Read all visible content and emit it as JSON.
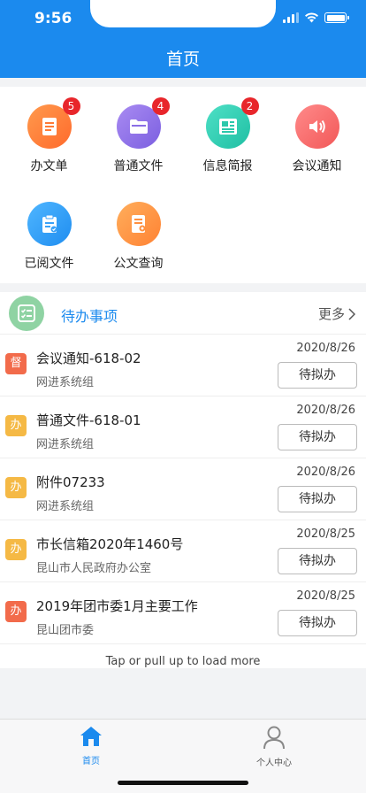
{
  "status_bar": {
    "time": "9:56"
  },
  "header": {
    "title": "首页"
  },
  "grid": [
    {
      "label": "办文单",
      "badge": "5",
      "icon": "document-icon",
      "color_from": "#ff9a4d",
      "color_to": "#ff6a2c"
    },
    {
      "label": "普通文件",
      "badge": "4",
      "icon": "folder-icon",
      "color_from": "#a98bf2",
      "color_to": "#7b5fe0"
    },
    {
      "label": "信息简报",
      "badge": "2",
      "icon": "newspaper-icon",
      "color_from": "#4ee0c6",
      "color_to": "#1fbfa3"
    },
    {
      "label": "会议通知",
      "badge": null,
      "icon": "speaker-icon",
      "color_from": "#ff8a8a",
      "color_to": "#f25858"
    },
    {
      "label": "已阅文件",
      "badge": null,
      "icon": "clipboard-check-icon",
      "color_from": "#4fb6ff",
      "color_to": "#1f8df0"
    },
    {
      "label": "公文查询",
      "badge": null,
      "icon": "doc-search-icon",
      "color_from": "#ffae5c",
      "color_to": "#ff8233"
    }
  ],
  "todo": {
    "title": "待办事项",
    "more_label": "更多",
    "rows": [
      {
        "tag": "督",
        "tag_color": "#f26b4b",
        "title": "会议通知-618-02",
        "org": "网进系统组",
        "date": "2020/8/26",
        "action": "待拟办"
      },
      {
        "tag": "办",
        "tag_color": "#f5b945",
        "title": "普通文件-618-01",
        "org": "网进系统组",
        "date": "2020/8/26",
        "action": "待拟办"
      },
      {
        "tag": "办",
        "tag_color": "#f5b945",
        "title": "附件07233",
        "org": "网进系统组",
        "date": "2020/8/26",
        "action": "待拟办"
      },
      {
        "tag": "办",
        "tag_color": "#f5b945",
        "title": "市长信箱2020年1460号",
        "org": "昆山市人民政府办公室",
        "date": "2020/8/25",
        "action": "待拟办"
      },
      {
        "tag": "办",
        "tag_color": "#f26b4b",
        "title": "2019年团市委1月主要工作",
        "org": "昆山团市委",
        "date": "2020/8/25",
        "action": "待拟办"
      }
    ],
    "load_more": "Tap or pull up to load more"
  },
  "tabbar": {
    "tabs": [
      {
        "label": "首页",
        "icon": "home-icon",
        "active": true
      },
      {
        "label": "个人中心",
        "icon": "person-icon",
        "active": false
      }
    ]
  },
  "colors": {
    "primary": "#1b8aee"
  }
}
